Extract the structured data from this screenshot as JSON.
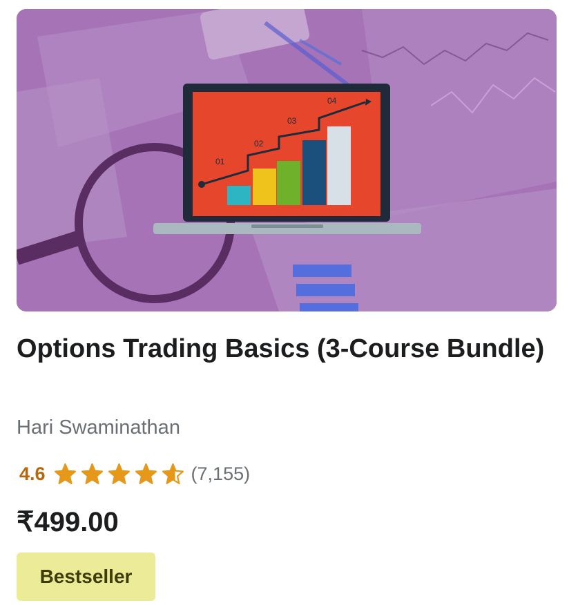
{
  "course": {
    "title": "Options Trading Basics (3-Course Bundle)",
    "instructor": "Hari Swaminathan",
    "rating_value": "4.6",
    "rating_fraction": 0.92,
    "rating_count": "(7,155)",
    "price": "₹499.00",
    "badge": "Bestseller"
  },
  "thumbnail": {
    "icons": [
      "laptop-icon",
      "bar-chart-icon",
      "magnifying-glass-icon"
    ],
    "step_labels": [
      "01",
      "02",
      "03",
      "04"
    ],
    "colors": {
      "background": "#a573b6",
      "screen": "#e5462c",
      "laptop_frame": "#1f2a3a"
    }
  },
  "colors": {
    "rating": "#b4690e",
    "star": "#e59819",
    "muted_text": "#6a6f73",
    "badge_bg": "#eceb98"
  }
}
